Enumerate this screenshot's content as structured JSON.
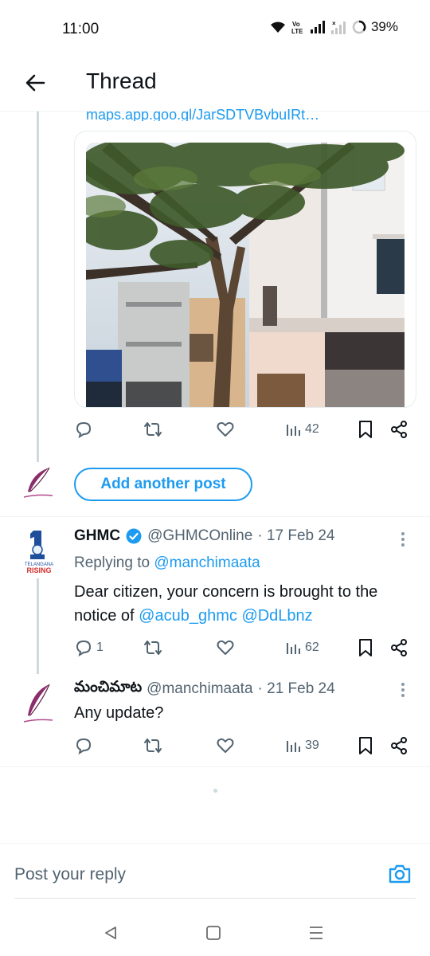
{
  "status_bar": {
    "time": "11:00",
    "battery": "39%",
    "icons": [
      "wifi-icon",
      "volte-icon",
      "signal-icon",
      "signal-no-sim-icon",
      "battery-icon"
    ]
  },
  "header": {
    "title": "Thread",
    "back_icon": "back-arrow-icon"
  },
  "original_post": {
    "link_preview": "maps.app.goo.gl/JarSDTVBvbuIRt…",
    "photo_description_icon": "photo",
    "actions": {
      "reply_count": "",
      "repost_count": "",
      "like_count": "",
      "views": "42"
    }
  },
  "add_post": {
    "label": "Add another post"
  },
  "replies": [
    {
      "name": "GHMC",
      "verified": true,
      "handle": "@GHMCOnline",
      "date": "· 17 Feb 24",
      "replying_to_label": "Replying to",
      "replying_to_handle": "@manchimaata",
      "body_prefix": "Dear citizen, your concern is brought to the notice of ",
      "mention_1": "@acub_ghmc",
      "mention_2": "@DdLbnz",
      "avatar_text_1": "TELANGANA",
      "avatar_text_2": "RISING",
      "actions": {
        "reply_count": "1",
        "views": "62"
      }
    },
    {
      "name": "మంచిమాట",
      "handle": "@manchimaata",
      "date": "· 21 Feb 24",
      "body": "Any update?",
      "actions": {
        "reply_count": "",
        "views": "39"
      }
    }
  ],
  "composer": {
    "placeholder": "Post your reply",
    "camera_icon": "camera-icon"
  },
  "nav_bar": {
    "buttons": [
      "back-triangle-icon",
      "home-square-icon",
      "recents-menu-icon"
    ]
  },
  "colors": {
    "accent": "#1d9bf0",
    "muted": "#536471",
    "text": "#0f1419",
    "thread_line": "#cfd9de"
  }
}
